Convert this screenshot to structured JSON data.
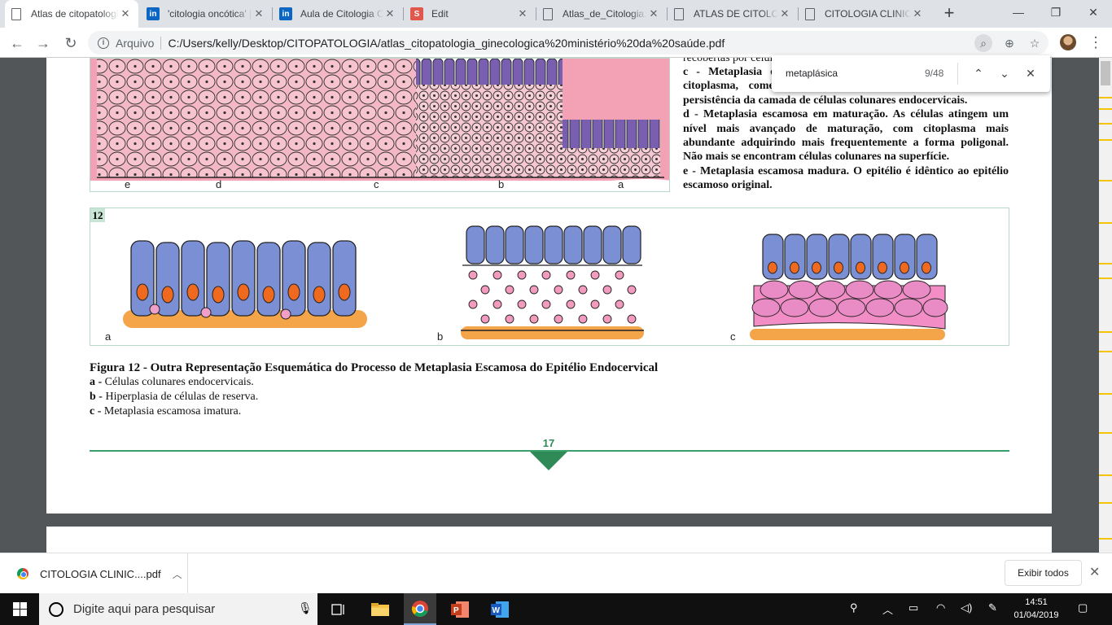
{
  "tabs": [
    {
      "title": "Atlas de citopatologia ginecologica ministério da saúde.pdf",
      "icon": "document-icon",
      "active": true
    },
    {
      "title": "'citologia oncótica' | LinkedIn",
      "icon": "linkedin-icon"
    },
    {
      "title": "Aula de Citologia Clínica | LinkedIn",
      "icon": "linkedin-icon"
    },
    {
      "title": "Edit",
      "icon": "slideshare-icon"
    },
    {
      "title": "Atlas_de_Citologia.pdf",
      "icon": "document-icon"
    },
    {
      "title": "ATLAS DE CITOLOGIA.pdf",
      "icon": "document-icon"
    },
    {
      "title": "CITOLOGIA CLINICA.pdf",
      "icon": "document-icon"
    }
  ],
  "toolbar": {
    "scheme_label": "Arquivo",
    "url": "C:/Users/kelly/Desktop/CITOPATOLOGIA/atlas_citopatologia_ginecologica%20ministério%20da%20saúde.pdf"
  },
  "find": {
    "query": "metaplásica",
    "count": "9/48"
  },
  "pdf": {
    "top_labels": [
      "e",
      "d",
      "c",
      "b",
      "a"
    ],
    "desc_lines": [
      {
        "prefix": "",
        "text": "recobertas por células colunares."
      },
      {
        "prefix": "c - ",
        "text": "Metaplasia escamosa imatura. As células possuem mais citoplasma, começando a se estratificar e há, por vezes, persistência da camada de células colunares endocervicais."
      },
      {
        "prefix": "d - ",
        "text": "Metaplasia escamosa em maturação. As células atingem um nível mais avançado de maturação, com citoplasma mais abundante adquirindo mais frequentemente a forma poligonal. Não mais se encontram células colunares na superfície."
      },
      {
        "prefix": "e - ",
        "text": "Metaplasia escamosa madura. O epitélio é idêntico ao epitélio escamoso original."
      }
    ],
    "fig_number": "12",
    "panel_labels": [
      "a",
      "b",
      "c"
    ],
    "caption_title": "Figura 12 - Outra Representação Esquemática do Processo de Metaplasia Escamosa do Epitélio Endocervical",
    "caption_items": [
      {
        "prefix": "a - ",
        "text": "Células colunares endocervicais."
      },
      {
        "prefix": "b - ",
        "text": "Hiperplasia de células de reserva."
      },
      {
        "prefix": "c - ",
        "text": "Metaplasia escamosa imatura."
      }
    ],
    "page_number": "17"
  },
  "download": {
    "file": "CITOLOGIA CLINIC....pdf",
    "show_all": "Exibir todos"
  },
  "taskbar": {
    "search_placeholder": "Digite aqui para pesquisar",
    "time": "14:51",
    "date": "01/04/2019"
  },
  "colors": {
    "accent_green": "#2f8a58",
    "cell_pink": "#f2a2b4",
    "cell_purple": "#7a5fb0",
    "nucleus_orange": "#ef6a1f"
  }
}
